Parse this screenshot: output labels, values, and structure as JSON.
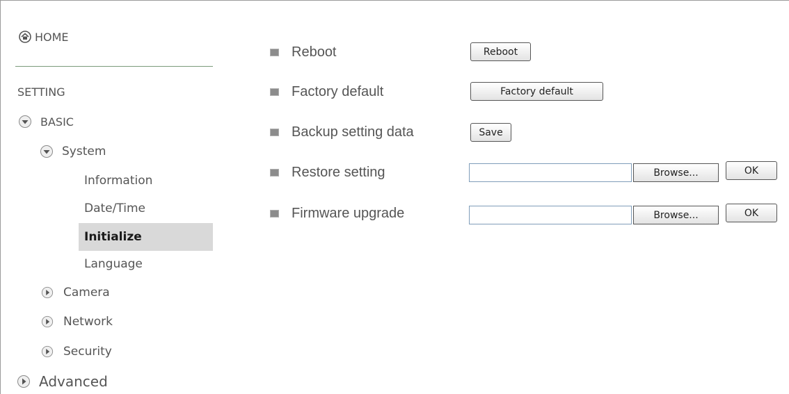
{
  "sidebar": {
    "home": "HOME",
    "setting_heading": "SETTING",
    "basic": "BASIC",
    "system": "System",
    "information": "Information",
    "datetime": "Date/Time",
    "initialize": "Initialize",
    "language": "Language",
    "camera": "Camera",
    "network": "Network",
    "security": "Security",
    "advanced": "Advanced"
  },
  "main": {
    "reboot": {
      "label": "Reboot",
      "button": "Reboot"
    },
    "factory_default": {
      "label": "Factory default",
      "button": "Factory default"
    },
    "backup": {
      "label": "Backup setting data",
      "button": "Save"
    },
    "restore": {
      "label": "Restore setting",
      "file_value": "",
      "browse": "Browse...",
      "ok": "OK"
    },
    "firmware": {
      "label": "Firmware upgrade",
      "file_value": "",
      "browse": "Browse...",
      "ok": "OK"
    }
  },
  "colors": {
    "active_bg": "#d9d9d9",
    "bullet": "#8c8c8c",
    "divider": "#7a9a7a"
  },
  "icons": {
    "home": "home-icon",
    "expanded": "chevron-down-icon",
    "collapsed": "chevron-right-icon"
  }
}
